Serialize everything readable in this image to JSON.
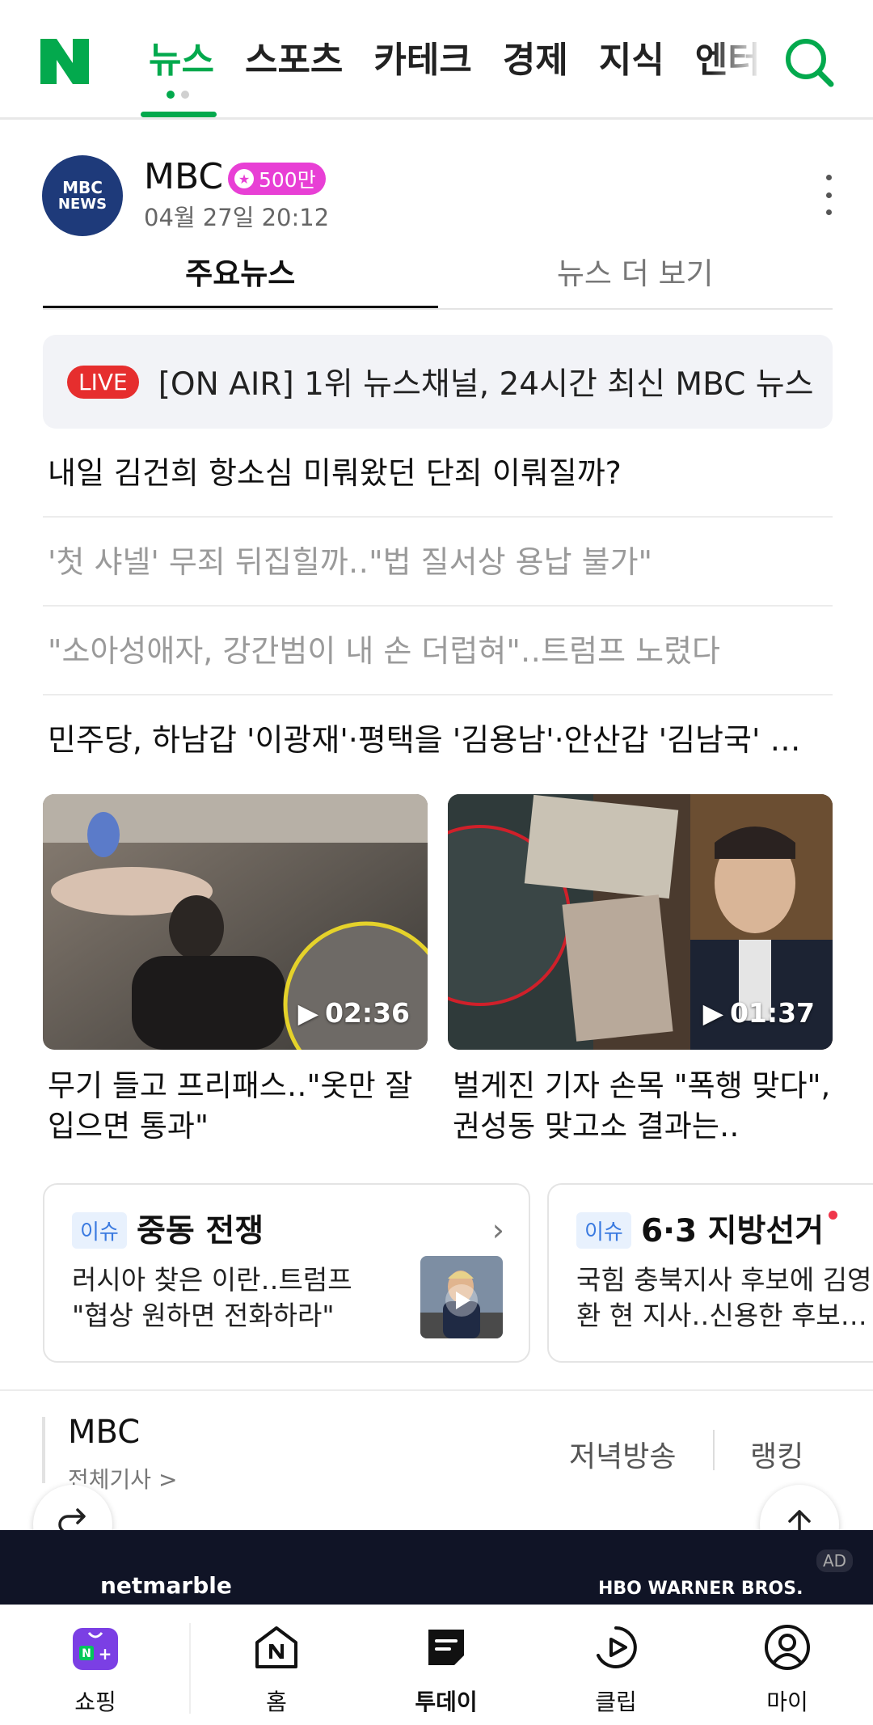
{
  "nav": {
    "tabs": [
      "뉴스",
      "스포츠",
      "카테크",
      "경제",
      "지식",
      "엔터"
    ],
    "active_tab": "뉴스"
  },
  "press": {
    "logo_line1": "MBC",
    "logo_line2": "NEWS",
    "name": "MBC",
    "subscribers": "500만",
    "date": "04월 27일 20:12",
    "subtabs": [
      "주요뉴스",
      "뉴스 더 보기"
    ]
  },
  "live": {
    "badge": "LIVE",
    "text": "[ON AIR] 1위 뉴스채널, 24시간 최신 MBC 뉴스"
  },
  "headlines": [
    "내일 김건희 항소심 미뤄왔던 단죄 이뤄질까?",
    "'첫 샤넬' 무죄 뒤집힐까‥\"법 질서상 용납 불가\"",
    "\"소아성애자, 강간범이 내 손 더럽혀\"‥트럼프 노렸다",
    "민주당, 하남갑 '이광재'·평택을 '김용남'·안산갑 '김남국' …"
  ],
  "videos": [
    {
      "duration": "02:36",
      "title": "무기 들고 프리패스‥\"옷만 잘 입으면 통과\""
    },
    {
      "duration": "01:37",
      "title": "벌게진 기자 손목 \"폭행 맞다\", 권성동 맞고소 결과는‥"
    }
  ],
  "issues": [
    {
      "badge": "이슈",
      "title": "중동 전쟁",
      "body_line1": "러시아 찾은 이란‥트럼프",
      "body_line2": "\"협상 원하면 전화하라\""
    },
    {
      "badge": "이슈",
      "title": "6·3 지방선거",
      "body_line1": "국힘 충북지사 후보에 김영",
      "body_line2": "환 현 지사‥신용한 후보…"
    }
  ],
  "press_footer": {
    "name": "MBC",
    "all_articles": "전체기사 >",
    "link1": "저녁방송",
    "link2": "랭킹"
  },
  "ad": {
    "brand": "netmarble",
    "partners": "HBO  WARNER BROS.",
    "tag": "AD"
  },
  "bottom_nav": [
    "쇼핑",
    "홈",
    "투데이",
    "클립",
    "마이"
  ],
  "colors": {
    "naver_green": "#03a94d",
    "live_red": "#e62e2e",
    "badge_pink": "#e83fd5",
    "issue_blue": "#3a7ae0"
  }
}
